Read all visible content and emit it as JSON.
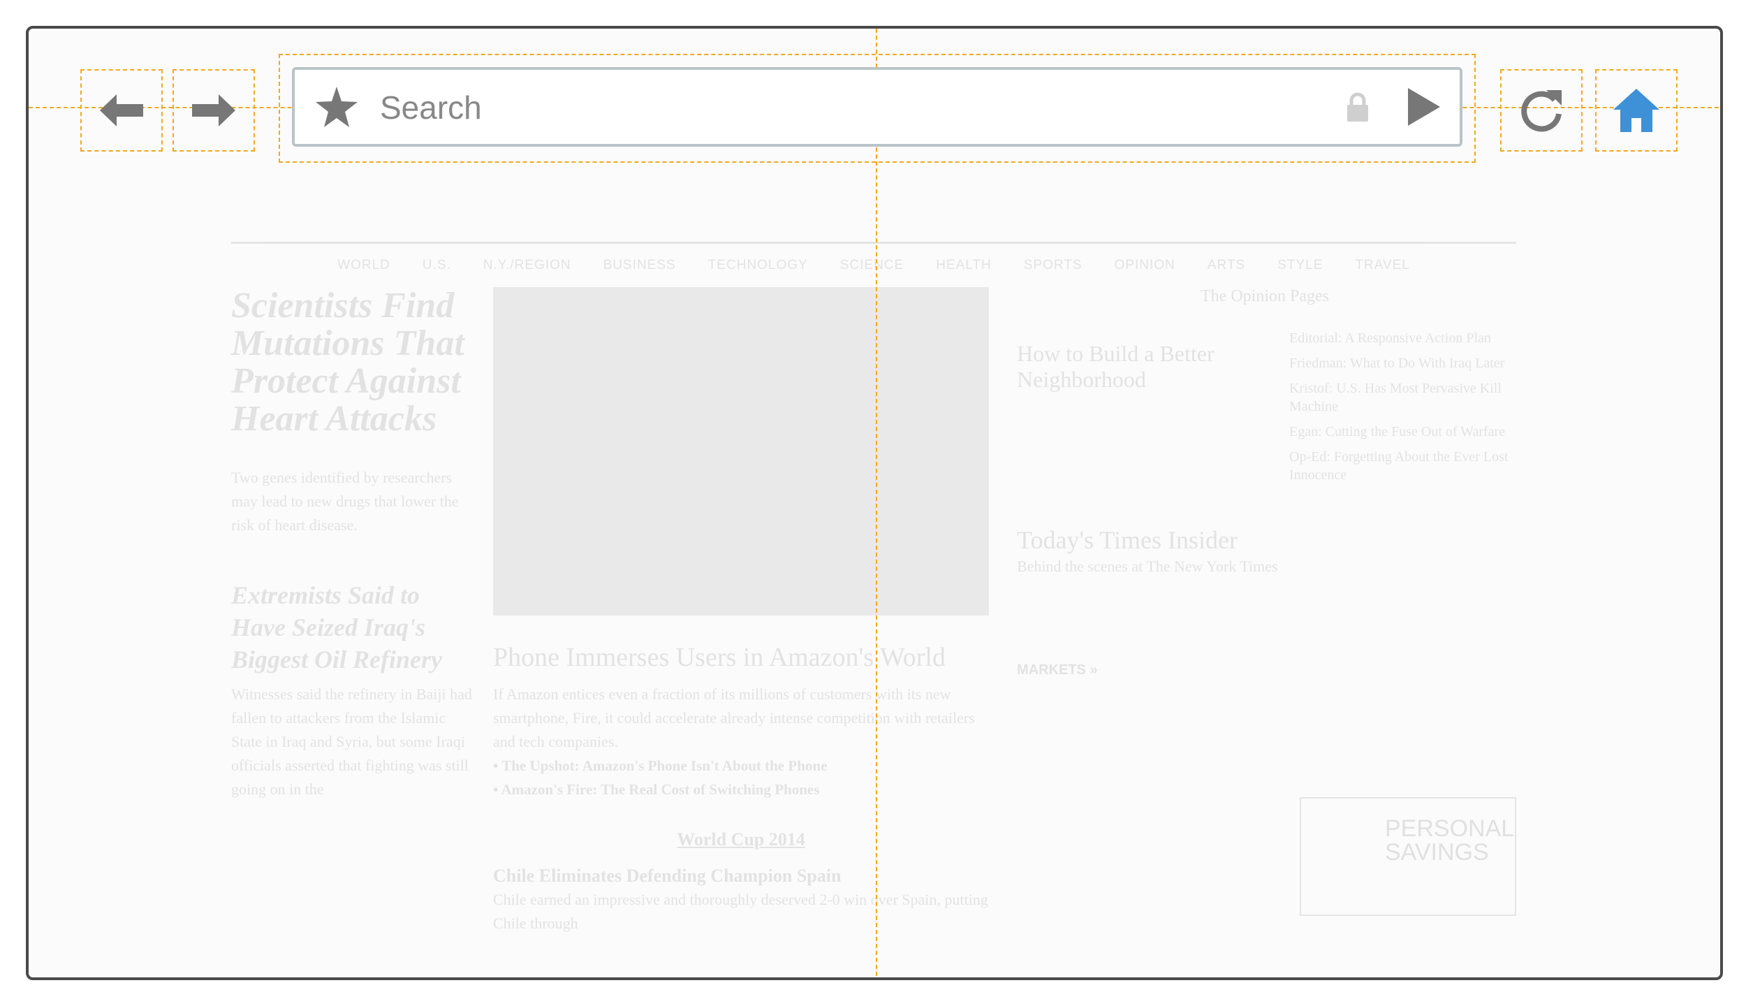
{
  "toolbar": {
    "search_placeholder": "Search",
    "icons": {
      "back": "arrow-left-icon",
      "forward": "arrow-right-icon",
      "bookmark": "star-icon",
      "secure": "lock-icon",
      "go": "play-icon",
      "reload": "reload-icon",
      "home": "home-icon"
    },
    "colors": {
      "icon": "#777777",
      "home": "#3e91d6",
      "guide": "#f3a820",
      "urlbar_border": "#b9c4c8"
    }
  },
  "page": {
    "nav": [
      "WORLD",
      "U.S.",
      "N.Y./REGION",
      "BUSINESS",
      "TECHNOLOGY",
      "SCIENCE",
      "HEALTH",
      "SPORTS",
      "OPINION",
      "ARTS",
      "STYLE",
      "TRAVEL"
    ],
    "left": {
      "headline1": "Scientists Find Mutations That Protect Against Heart Attacks",
      "body1": "Two genes identified by researchers may lead to new drugs that lower the risk of heart disease.",
      "headline2": "Extremists Said to Have Seized Iraq's Biggest Oil Refinery",
      "body2": "Witnesses said the refinery in Baiji had fallen to attackers from the Islamic State in Iraq and Syria, but some Iraqi officials asserted that fighting was still going on in the"
    },
    "middle": {
      "headline": "Phone Immerses Users in Amazon's World",
      "body": "If Amazon entices even a fraction of its millions of customers with its new smartphone, Fire, it could accelerate already intense competition with retailers and tech companies.",
      "link1": "• The Upshot: Amazon's Phone Isn't About the Phone",
      "link2": "• Amazon's Fire: The Real Cost of Switching Phones",
      "section": "World Cup 2014",
      "headline2": "Chile Eliminates Defending Champion Spain",
      "body2": "Chile earned an impressive and thoroughly deserved 2-0 win over Spain, putting Chile through"
    },
    "right": {
      "opinion_title": "The Opinion Pages",
      "opinion_main": "How to Build a Better Neighborhood",
      "opinion_list": [
        "Editorial: A Responsive Action Plan",
        "Friedman: What to Do With Iraq Later",
        "Kristof: U.S. Has Most Pervasive Kill Machine",
        "Egan: Cutting the Fuse Out of Warfare",
        "Op-Ed: Forgetting About the Ever Lost Innocence"
      ],
      "insider_title": "Today's Times Insider",
      "insider_sub": "Behind the scenes at The New York Times",
      "markets": "MARKETS »",
      "ad": "PERSONAL SAVINGS"
    }
  }
}
